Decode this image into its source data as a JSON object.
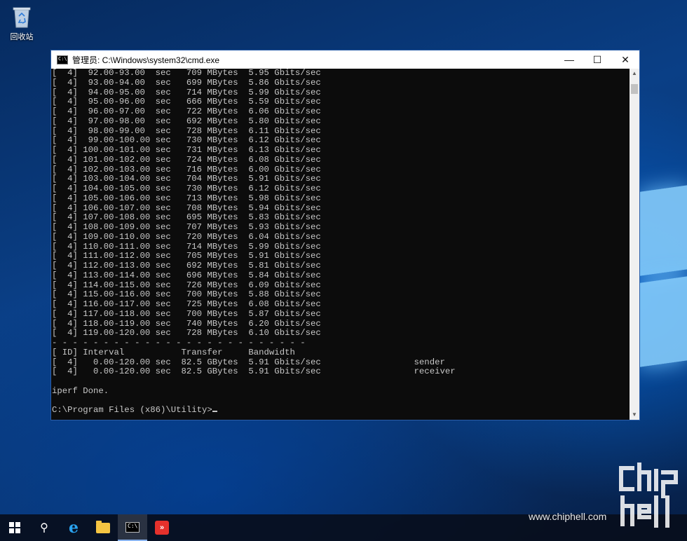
{
  "desktop": {
    "recycle_bin_label": "回收站"
  },
  "window": {
    "title": "管理员: C:\\Windows\\system32\\cmd.exe",
    "icon_text": "C:\\",
    "minimize_glyph": "—",
    "maximize_glyph": "☐",
    "close_glyph": "✕"
  },
  "console": {
    "lines": [
      "[  4]  92.00-93.00  sec   709 MBytes  5.95 Gbits/sec",
      "[  4]  93.00-94.00  sec   699 MBytes  5.86 Gbits/sec",
      "[  4]  94.00-95.00  sec   714 MBytes  5.99 Gbits/sec",
      "[  4]  95.00-96.00  sec   666 MBytes  5.59 Gbits/sec",
      "[  4]  96.00-97.00  sec   722 MBytes  6.06 Gbits/sec",
      "[  4]  97.00-98.00  sec   692 MBytes  5.80 Gbits/sec",
      "[  4]  98.00-99.00  sec   728 MBytes  6.11 Gbits/sec",
      "[  4]  99.00-100.00 sec   730 MBytes  6.12 Gbits/sec",
      "[  4] 100.00-101.00 sec   731 MBytes  6.13 Gbits/sec",
      "[  4] 101.00-102.00 sec   724 MBytes  6.08 Gbits/sec",
      "[  4] 102.00-103.00 sec   716 MBytes  6.00 Gbits/sec",
      "[  4] 103.00-104.00 sec   704 MBytes  5.91 Gbits/sec",
      "[  4] 104.00-105.00 sec   730 MBytes  6.12 Gbits/sec",
      "[  4] 105.00-106.00 sec   713 MBytes  5.98 Gbits/sec",
      "[  4] 106.00-107.00 sec   708 MBytes  5.94 Gbits/sec",
      "[  4] 107.00-108.00 sec   695 MBytes  5.83 Gbits/sec",
      "[  4] 108.00-109.00 sec   707 MBytes  5.93 Gbits/sec",
      "[  4] 109.00-110.00 sec   720 MBytes  6.04 Gbits/sec",
      "[  4] 110.00-111.00 sec   714 MBytes  5.99 Gbits/sec",
      "[  4] 111.00-112.00 sec   705 MBytes  5.91 Gbits/sec",
      "[  4] 112.00-113.00 sec   692 MBytes  5.81 Gbits/sec",
      "[  4] 113.00-114.00 sec   696 MBytes  5.84 Gbits/sec",
      "[  4] 114.00-115.00 sec   726 MBytes  6.09 Gbits/sec",
      "[  4] 115.00-116.00 sec   700 MBytes  5.88 Gbits/sec",
      "[  4] 116.00-117.00 sec   725 MBytes  6.08 Gbits/sec",
      "[  4] 117.00-118.00 sec   700 MBytes  5.87 Gbits/sec",
      "[  4] 118.00-119.00 sec   740 MBytes  6.20 Gbits/sec",
      "[  4] 119.00-120.00 sec   728 MBytes  6.10 Gbits/sec",
      "- - - - - - - - - - - - - - - - - - - - - - - - -",
      "[ ID] Interval           Transfer     Bandwidth",
      "[  4]   0.00-120.00 sec  82.5 GBytes  5.91 Gbits/sec                  sender",
      "[  4]   0.00-120.00 sec  82.5 GBytes  5.91 Gbits/sec                  receiver",
      "",
      "iperf Done.",
      ""
    ],
    "prompt": "C:\\Program Files (x86)\\Utility>"
  },
  "scrollbar": {
    "up_glyph": "▲",
    "down_glyph": "▼"
  },
  "taskbar": {
    "search_glyph": "⚲",
    "ie_glyph": "e",
    "cmd_glyph": "C:\\",
    "app_glyph": "»"
  },
  "watermark": {
    "site": "www.chiphell.com",
    "logo_text": "chip hell"
  }
}
